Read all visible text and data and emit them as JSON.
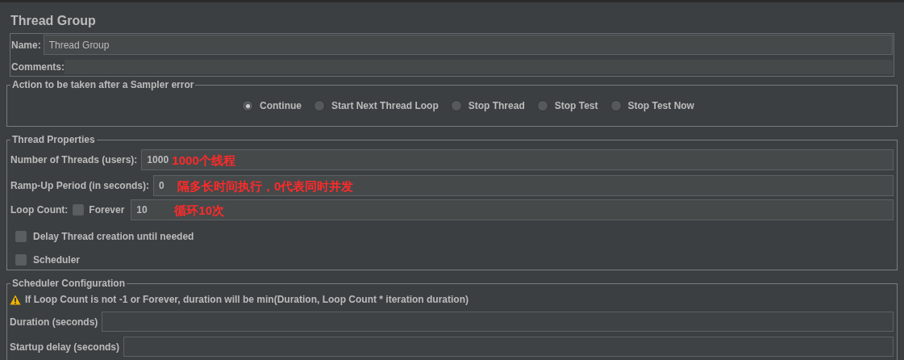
{
  "title": "Thread Group",
  "name_field": {
    "label": "Name:",
    "value": "Thread Group"
  },
  "comments_field": {
    "label": "Comments:"
  },
  "sampler_error": {
    "legend": "Action to be taken after a Sampler error",
    "options": [
      {
        "label": "Continue",
        "selected": true
      },
      {
        "label": "Start Next Thread Loop",
        "selected": false
      },
      {
        "label": "Stop Thread",
        "selected": false
      },
      {
        "label": "Stop Test",
        "selected": false
      },
      {
        "label": "Stop Test Now",
        "selected": false
      }
    ]
  },
  "thread_properties": {
    "legend": "Thread Properties",
    "threads": {
      "label": "Number of Threads (users):",
      "value": "1000",
      "annotation": "1000个线程"
    },
    "ramp_up": {
      "label": "Ramp-Up Period (in seconds):",
      "value": "0",
      "annotation": "隔多长时间执行，0代表同时并发"
    },
    "loop": {
      "label": "Loop Count:",
      "forever": {
        "label": "Forever",
        "checked": false
      },
      "value": "10",
      "annotation": "循环10次"
    },
    "checkboxes": [
      {
        "label": "Delay Thread creation until needed",
        "checked": false
      },
      {
        "label": "Scheduler",
        "checked": false
      }
    ]
  },
  "scheduler_config": {
    "legend": "Scheduler Configuration",
    "warning": "If Loop Count is not -1 or Forever, duration will be min(Duration, Loop Count * iteration duration)",
    "fields": [
      {
        "label": "Duration (seconds)"
      },
      {
        "label": "Startup delay (seconds)"
      }
    ]
  }
}
